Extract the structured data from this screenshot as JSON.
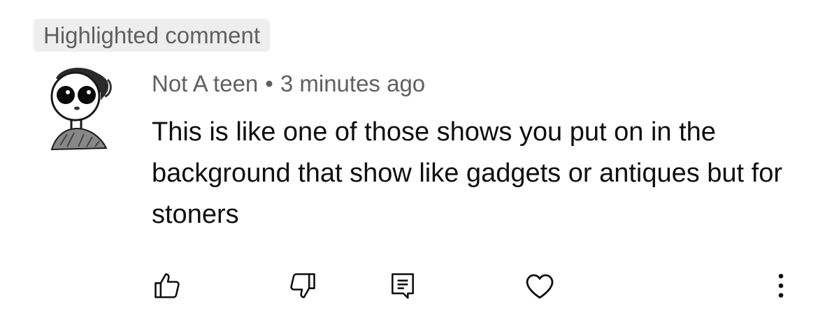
{
  "badge": {
    "label": "Highlighted comment"
  },
  "comment": {
    "author": "Not A teen",
    "separator": "•",
    "time": "3 minutes ago",
    "text": "This is like one of those shows you put on in the background that show like gadgets or antiques but for stoners"
  },
  "actions": {
    "like_icon": "thumbs-up-icon",
    "dislike_icon": "thumbs-down-icon",
    "reply_icon": "reply-comment-icon",
    "heart_icon": "heart-icon",
    "more_icon": "more-vertical-icon"
  }
}
